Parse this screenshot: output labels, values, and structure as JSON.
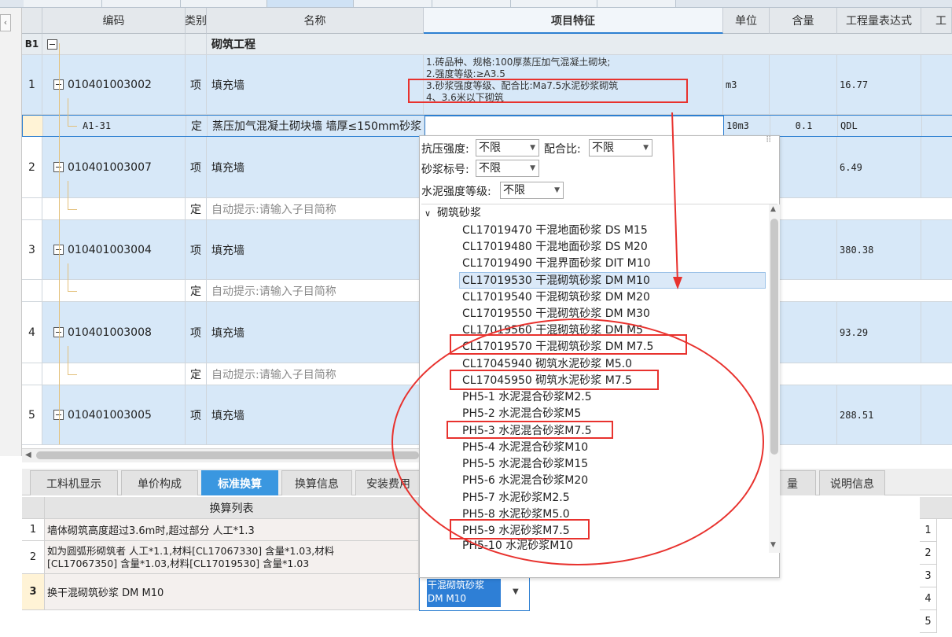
{
  "grid": {
    "headers": [
      "编码",
      "类别",
      "名称",
      "项目特征",
      "单位",
      "含量",
      "工程量表达式",
      "工"
    ],
    "section": {
      "label": "B1",
      "title": "砌筑工程"
    },
    "rows": [
      {
        "num": "1",
        "code": "010401003002",
        "type": "项",
        "name": "填充墙",
        "feature": "1.砖品种、规格:100厚蒸压加气混凝土砌块;\n2.强度等级:≥A3.5\n3.砂浆强度等级、配合比:Ma7.5水泥砂浆砌筑\n4、3.6米以下砌筑",
        "unit": "m3",
        "content": "",
        "expr": "16.77"
      },
      {
        "num": "",
        "code": "A1-31",
        "type": "定",
        "name": "蒸压加气混凝土砌块墙 墙厚≤150mm砂浆",
        "feature": "",
        "unit": "10m3",
        "content": "0.1",
        "expr": "QDL"
      },
      {
        "num": "2",
        "code": "010401003007",
        "type": "项",
        "name": "填充墙",
        "expr": "6.49"
      },
      {
        "num": "",
        "type": "定",
        "name": "自动提示:请输入子目简称"
      },
      {
        "num": "3",
        "code": "010401003004",
        "type": "项",
        "name": "填充墙",
        "expr": "380.38"
      },
      {
        "num": "",
        "type": "定",
        "name": "自动提示:请输入子目简称"
      },
      {
        "num": "4",
        "code": "010401003008",
        "type": "项",
        "name": "填充墙",
        "expr": "93.29"
      },
      {
        "num": "",
        "type": "定",
        "name": "自动提示:请输入子目简称"
      },
      {
        "num": "5",
        "code": "010401003005",
        "type": "项",
        "name": "填充墙",
        "expr": "288.51"
      }
    ]
  },
  "bottom_tabs": [
    "工料机显示",
    "单价构成",
    "标准换算",
    "换算信息",
    "安装费用",
    "量",
    "说明信息"
  ],
  "bottom_table": {
    "header": "换算列表",
    "rows": [
      {
        "num": "1",
        "text": "墙体砌筑高度超过3.6m时,超过部分 人工*1.3"
      },
      {
        "num": "2",
        "text": "如为圆弧形砌筑者 人工*1.1,材料[CL17067330] 含量*1.03,材料\n[CL17067350] 含量*1.03,材料[CL17019530] 含量*1.03"
      },
      {
        "num": "3",
        "text": "换干混砌筑砂浆 DM M10"
      }
    ],
    "edit_value": "干混砌筑砂浆\nDM M10"
  },
  "right_mini": [
    "1",
    "2",
    "3",
    "4",
    "5"
  ],
  "dropdown": {
    "filters": [
      {
        "label": "抗压强度:",
        "value": "不限"
      },
      {
        "label": "配合比:",
        "value": "不限"
      },
      {
        "label": "砂浆标号:",
        "value": "不限"
      },
      {
        "label": "水泥强度等级:",
        "value": "不限"
      }
    ],
    "group": "砌筑砂浆",
    "items": [
      "CL17019470  干混地面砂浆 DS M15",
      "CL17019480  干混地面砂浆 DS M20",
      "CL17019490  干混界面砂浆 DIT M10",
      "CL17019530  干混砌筑砂浆 DM M10",
      "CL17019540  干混砌筑砂浆 DM M20",
      "CL17019550  干混砌筑砂浆 DM M30",
      "CL17019560  干混砌筑砂浆 DM M5",
      "CL17019570  干混砌筑砂浆 DM M7.5",
      "CL17045940  砌筑水泥砂浆 M5.0",
      "CL17045950  砌筑水泥砂浆 M7.5",
      "PH5-1  水泥混合砂浆M2.5",
      "PH5-2  水泥混合砂浆M5",
      "PH5-3  水泥混合砂浆M7.5",
      "PH5-4  水泥混合砂浆M10",
      "PH5-5  水泥混合砂浆M15",
      "PH5-6  水泥混合砂浆M20",
      "PH5-7  水泥砂浆M2.5",
      "PH5-8  水泥砂浆M5.0",
      "PH5-9  水泥砂浆M7.5",
      "PH5-10  水泥砂浆M10"
    ]
  },
  "colors": {
    "accent": "#2d7fd1",
    "annotation": "#e8322e",
    "selected_row": "#d7e8f8"
  }
}
